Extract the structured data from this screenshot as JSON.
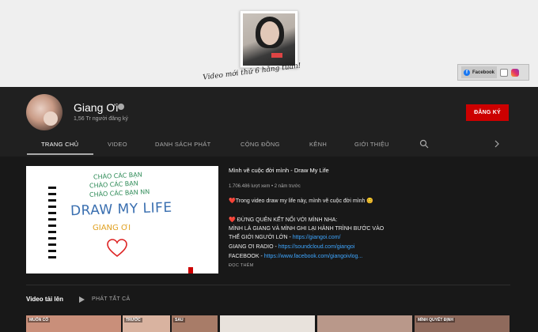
{
  "banner": {
    "script_text": "Video mới thứ 6 hằng tuần!",
    "social": {
      "facebook_label": "Facebook",
      "icons": [
        "facebook-icon",
        "soundcloud-icon",
        "instagram-icon"
      ]
    }
  },
  "channel": {
    "name": "Giang Ơi",
    "subscribers": "1,56 Tr người đăng ký",
    "subscribe_label": "ĐĂNG KÝ"
  },
  "tabs": [
    "TRANG CHỦ",
    "VIDEO",
    "DANH SÁCH PHÁT",
    "CỘNG ĐỒNG",
    "KÊNH",
    "GIỚI THIỆU"
  ],
  "featured": {
    "thumb_text": [
      "CHÀO CÁC BẠN",
      "CHÀO CÁC BẠN",
      "CHÀO CÁC BẠN NN",
      "DRAW MY LIFE",
      "GIANG ƠI"
    ],
    "title": "Mình vẽ cuộc đời mình - Draw My Life",
    "meta": "1.706.486 lượt xem • 2 năm trước",
    "desc": {
      "l1_emoji": "❤️",
      "l1_text": "Trong video draw my life này, mình vẽ cuộc đời mình 😊",
      "l2_emoji": "❤️",
      "l2_text": " ĐỪNG QUÊN KẾT NỐI VỚI MÌNH NHA:",
      "l3": "MÌNH LÀ GIANG VÀ MÌNH GHI LẠI HÀNH TRÌNH BƯỚC VÀO",
      "l4_text": "THẾ GIỚI NGƯỜI LỚN - ",
      "l4_link": "https://giangoi.com/",
      "l5_text": "GIANG ƠI RADIO - ",
      "l5_link": "https://soundcloud.com/giangoi",
      "l6_text": "FACEBOOK - ",
      "l6_link": "https://www.facebook.com/giangoivlog..."
    },
    "read_more": "ĐỌC THÊM"
  },
  "uploads": {
    "title": "Video tải lên",
    "play_all": "PHÁT TẤT CẢ",
    "thumbs": [
      {
        "label": "MUỐN CÓ",
        "color": "#c98f7a"
      },
      {
        "label": "TRƯỚC",
        "color": "#d9b3a0"
      },
      {
        "label": "SAU",
        "color": "#a87c68"
      },
      {
        "label": "",
        "color": "#e8e2dc"
      },
      {
        "label": "",
        "color": "#b9988a"
      },
      {
        "label": "MÌNH QUYẾT ĐỊNH",
        "color": "#8f6a5c"
      }
    ]
  },
  "colors": {
    "accent": "#cc0000",
    "link": "#3ea6ff",
    "background": "#181818",
    "header": "#202020"
  }
}
